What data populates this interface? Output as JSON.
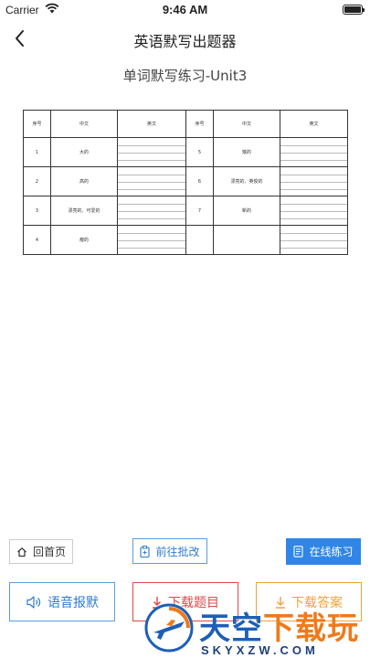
{
  "status_bar": {
    "carrier": "Carrier",
    "time": "9:46 AM"
  },
  "nav": {
    "title": "英语默写出题器"
  },
  "sheet": {
    "title": "单词默写练习-Unit3",
    "headers": [
      "序号",
      "中文",
      "英文",
      "序号",
      "中文",
      "英文"
    ],
    "rows": [
      {
        "n1": "1",
        "c1": "大的",
        "n2": "5",
        "c2": "矮的"
      },
      {
        "n1": "2",
        "c1": "高的",
        "n2": "6",
        "c2": "漂亮的、英俊的"
      },
      {
        "n1": "3",
        "c1": "漂亮的、可爱的",
        "n2": "7",
        "c2": "新的"
      },
      {
        "n1": "4",
        "c1": "瘦的",
        "n2": "",
        "c2": ""
      }
    ]
  },
  "buttons": {
    "home": "回首页",
    "correct": "前往批改",
    "online": "在线练习",
    "voice": "语音报默",
    "download_questions": "下载题目",
    "download_answers": "下载答案"
  },
  "watermark": {
    "main_a": "天空",
    "main_b": "下载玩",
    "sub": "SKYXZW.COM"
  },
  "colors": {
    "accent": "#2f86e6",
    "danger": "#e04848",
    "warning": "#f0a040"
  }
}
